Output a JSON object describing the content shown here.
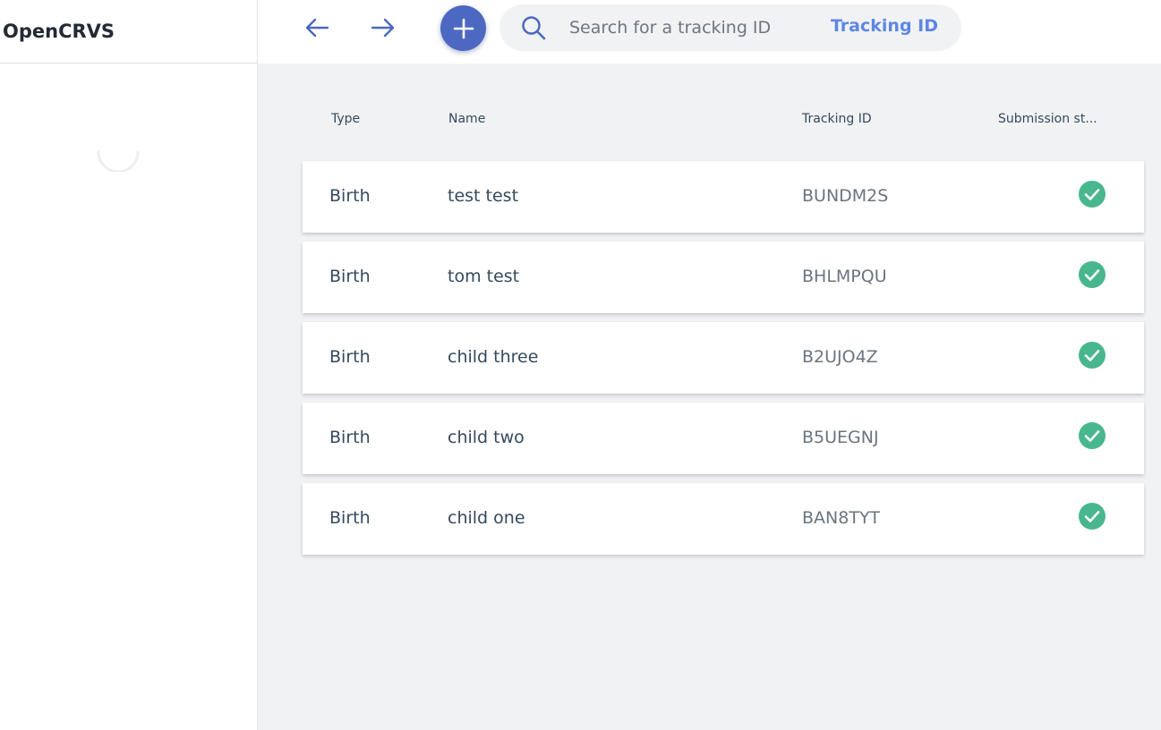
{
  "app": {
    "brand": "OpenCRVS"
  },
  "search": {
    "placeholder": "Search for a tracking ID",
    "type_label": "Tracking ID"
  },
  "table": {
    "headers": {
      "type": "Type",
      "name": "Name",
      "tracking_id": "Tracking ID",
      "submission_status": "Submission st..."
    },
    "rows": [
      {
        "type": "Birth",
        "name": "test test",
        "tracking_id": "BUNDM2S",
        "status": "submitted"
      },
      {
        "type": "Birth",
        "name": "tom test",
        "tracking_id": "BHLMPQU",
        "status": "submitted"
      },
      {
        "type": "Birth",
        "name": "child three",
        "tracking_id": "B2UJO4Z",
        "status": "submitted"
      },
      {
        "type": "Birth",
        "name": "child two",
        "tracking_id": "B5UEGNJ",
        "status": "submitted"
      },
      {
        "type": "Birth",
        "name": "child one",
        "tracking_id": "BAN8TYT",
        "status": "submitted"
      }
    ]
  },
  "colors": {
    "accent": "#4c68c1",
    "link": "#5d87e4",
    "success": "#49b78d",
    "background": "#f1f2f4"
  },
  "icons": {
    "back": "arrow-left-icon",
    "forward": "arrow-right-icon",
    "add": "plus-icon",
    "search": "search-icon",
    "status": "check-circle-icon",
    "loading": "spinner-icon"
  }
}
